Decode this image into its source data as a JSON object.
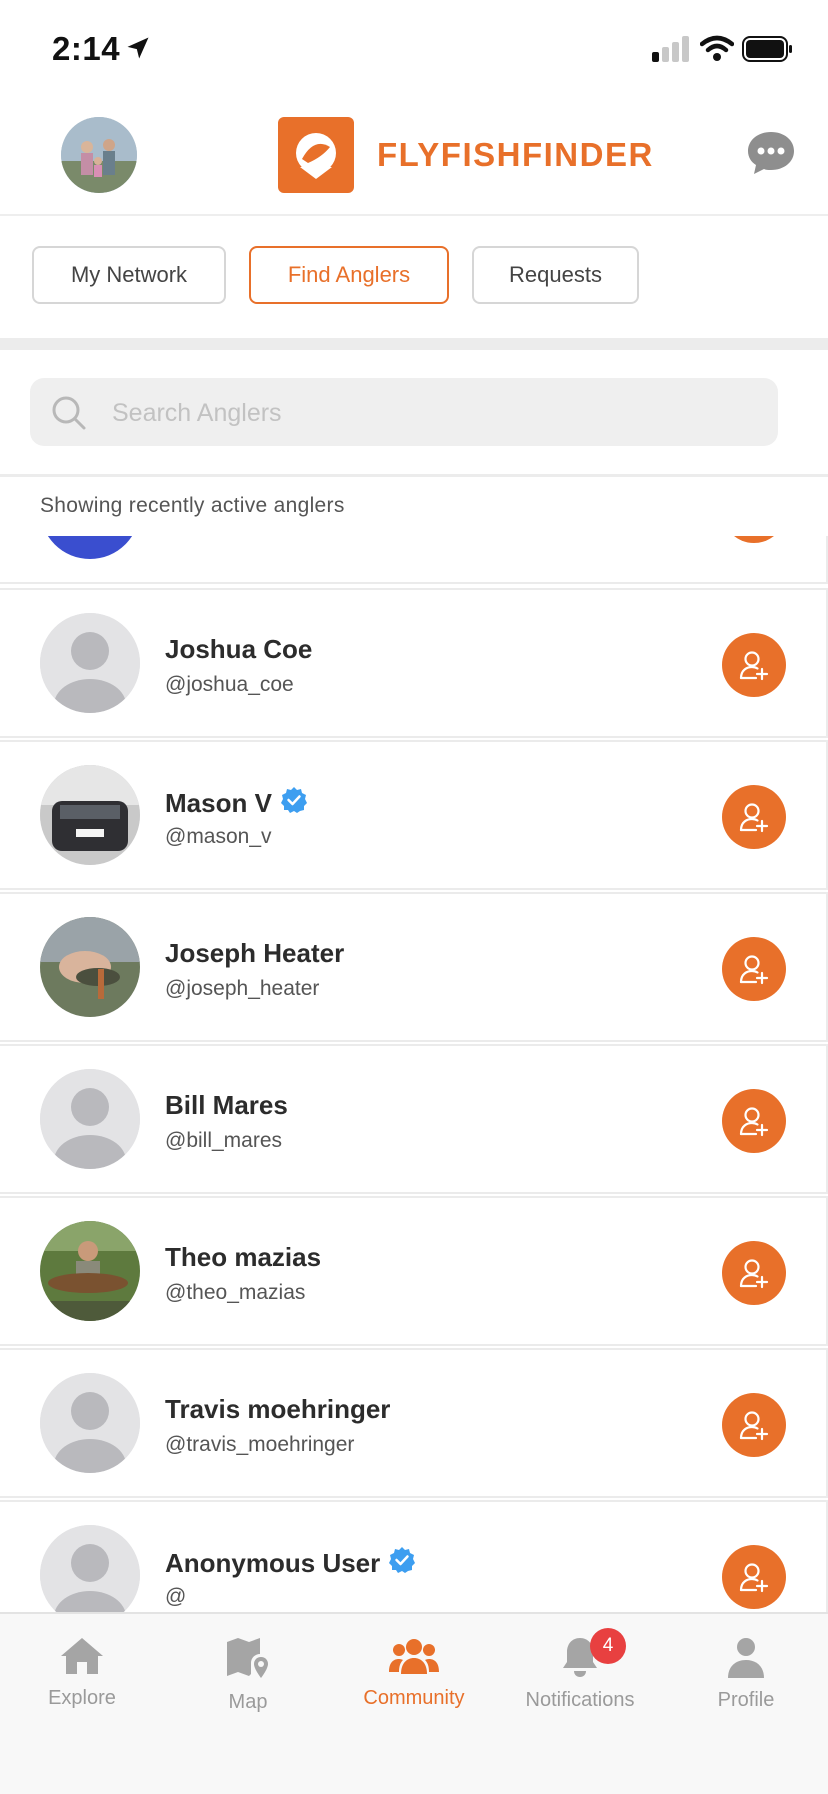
{
  "status_bar": {
    "time": "2:14"
  },
  "header": {
    "brand": "FLYFISHFINDER"
  },
  "tabs": [
    {
      "label": "My Network"
    },
    {
      "label": "Find Anglers"
    },
    {
      "label": "Requests"
    }
  ],
  "active_tab": "Find Anglers",
  "search": {
    "placeholder": "Search Anglers",
    "value": ""
  },
  "notice": "Showing recently active anglers",
  "anglers": [
    {
      "name": "Joshua Coe",
      "handle": "@joshua_coe",
      "verified": false,
      "avatar": "default-avatar"
    },
    {
      "name": "Mason V",
      "handle": "@mason_v",
      "verified": true,
      "avatar": "photo-car"
    },
    {
      "name": "Joseph Heater",
      "handle": "@joseph_heater",
      "verified": false,
      "avatar": "photo-fish-hand"
    },
    {
      "name": "Bill Mares",
      "handle": "@bill_mares",
      "verified": false,
      "avatar": "default-avatar"
    },
    {
      "name": "Theo mazias",
      "handle": "@theo_mazias",
      "verified": false,
      "avatar": "photo-angler-fish"
    },
    {
      "name": "Travis moehringer",
      "handle": "@travis_moehringer",
      "verified": false,
      "avatar": "default-avatar"
    },
    {
      "name": "Anonymous User",
      "handle": "@",
      "verified": true,
      "avatar": "default-avatar"
    }
  ],
  "nav": {
    "items": [
      {
        "label": "Explore",
        "icon": "house-icon"
      },
      {
        "label": "Map",
        "icon": "map-icon"
      },
      {
        "label": "Community",
        "icon": "community-icon"
      },
      {
        "label": "Notifications",
        "icon": "bell-icon"
      },
      {
        "label": "Profile",
        "icon": "person-icon"
      }
    ],
    "active": "Community",
    "notifications_badge": "4"
  },
  "colors": {
    "accent": "#e8702a",
    "verified": "#3d9ef0",
    "badge": "#e84040"
  }
}
